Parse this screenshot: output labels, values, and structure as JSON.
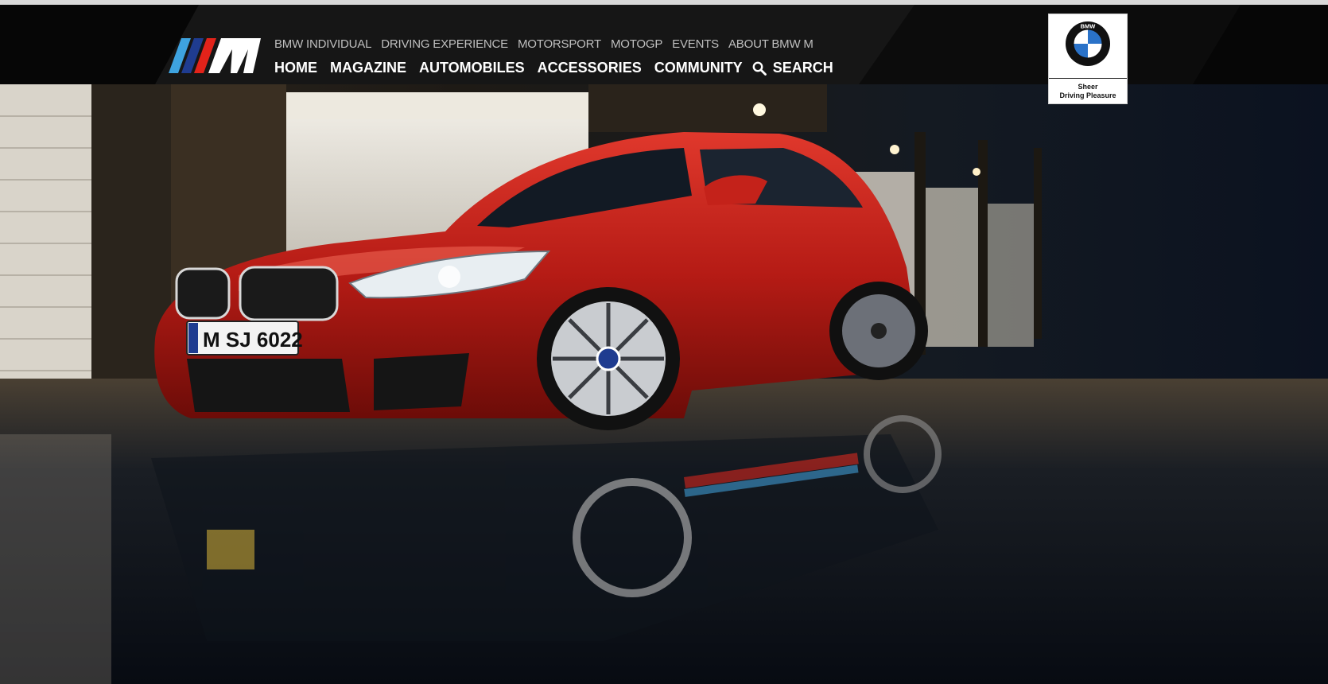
{
  "brand": {
    "m_logo_alt": "BMW M",
    "colors": {
      "m_light_blue": "#3ea3e0",
      "m_dark_blue": "#1f3c90",
      "m_red": "#e2231a",
      "accent_white": "#ffffff"
    }
  },
  "nav": {
    "secondary": [
      {
        "label": "BMW INDIVIDUAL"
      },
      {
        "label": "DRIVING EXPERIENCE"
      },
      {
        "label": "MOTORSPORT"
      },
      {
        "label": "MOTOGP"
      },
      {
        "label": "EVENTS"
      },
      {
        "label": "ABOUT BMW M"
      }
    ],
    "primary": [
      {
        "label": "HOME"
      },
      {
        "label": "MAGAZINE"
      },
      {
        "label": "AUTOMOBILES"
      },
      {
        "label": "ACCESSORIES"
      },
      {
        "label": "COMMUNITY"
      }
    ],
    "search": {
      "label": "SEARCH",
      "icon": "search-icon"
    }
  },
  "bmw_badge": {
    "letters": "BMW",
    "tagline": "Sheer\nDriving Pleasure"
  },
  "hero": {
    "description": "Red coupe parked in a wet garage pit lane",
    "license_plate": "M SJ 6022",
    "colors": {
      "car_red": "#c0201a",
      "floor": "#141a22"
    }
  }
}
